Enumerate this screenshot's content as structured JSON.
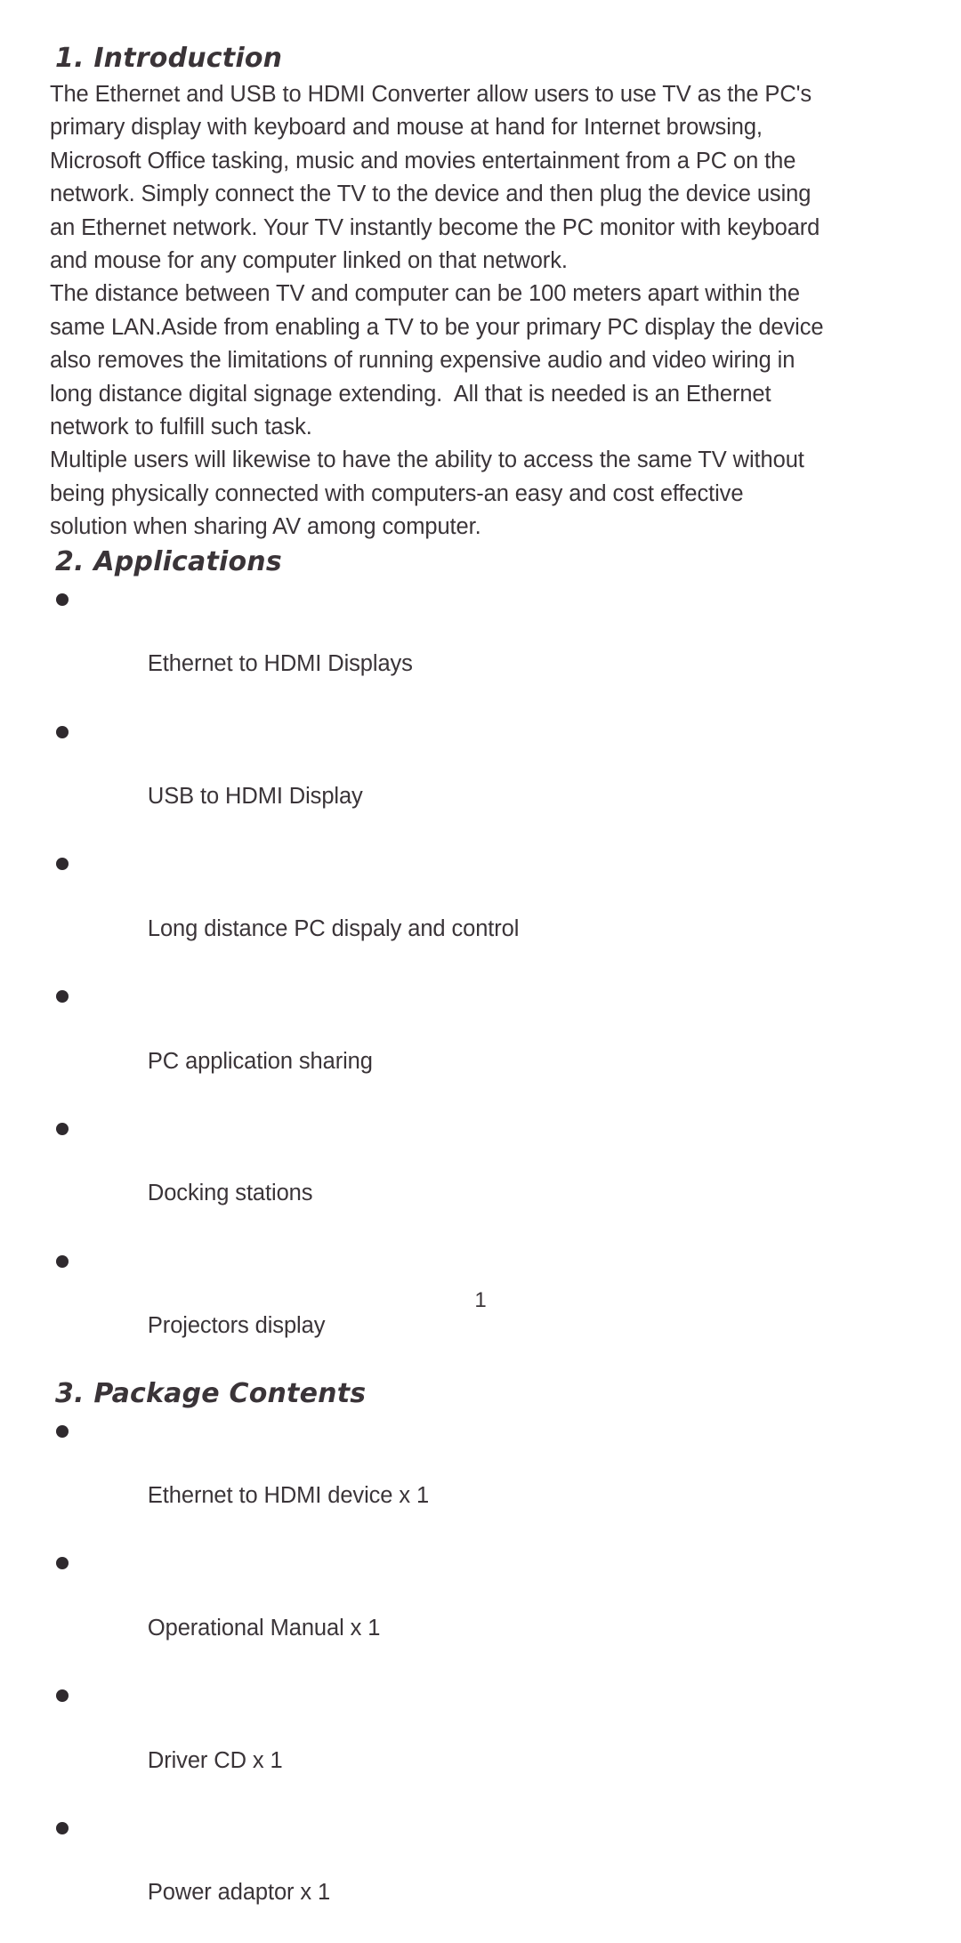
{
  "document": {
    "page_number": "1"
  },
  "sections": {
    "introduction": {
      "heading": "1. Introduction",
      "lines": [
        "The Ethernet and USB to HDMI Converter allow users to use TV as the PC's",
        "primary display with keyboard and mouse at hand for Internet browsing,",
        "Microsoft Office tasking, music and movies entertainment from a PC on the",
        "network. Simply connect the TV to the device and then plug the device using",
        "an Ethernet network. Your TV instantly become the PC monitor with keyboard",
        "and mouse for any computer linked on that network.",
        "The distance between TV and computer can be 100 meters apart within the",
        "same LAN.Aside from enabling a TV to be your primary PC display the device",
        "also removes the limitations of running expensive audio and video wiring in",
        "long distance digital signage extending.  All that is needed is an Ethernet",
        "network to fulfill such task.",
        "Multiple users will likewise to have the ability to access the same TV without",
        "being physically connected with computers-an easy and cost effective",
        "solution when sharing AV among computer."
      ]
    },
    "applications": {
      "heading": "2. Applications",
      "items": [
        "Ethernet to HDMI Displays",
        "USB to HDMI Display",
        "Long distance PC dispaly and control",
        "PC application sharing",
        "Docking stations",
        "Projectors display"
      ]
    },
    "package_contents": {
      "heading": "3. Package Contents",
      "items": [
        "Ethernet to HDMI device x 1",
        "Operational Manual x 1",
        "Driver CD x 1",
        "Power adaptor x 1"
      ]
    }
  }
}
